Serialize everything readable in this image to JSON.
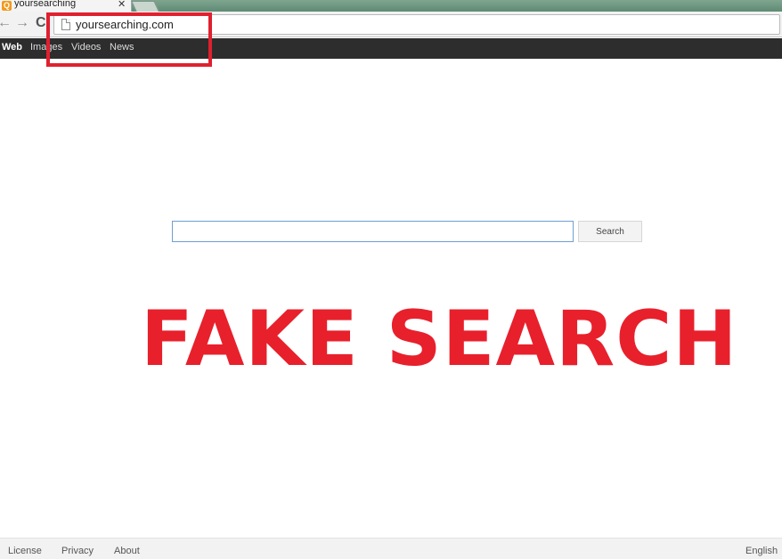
{
  "browser": {
    "tab": {
      "title": "yoursearching",
      "close_glyph": "✕",
      "favicon": "search-q-icon"
    },
    "nav": {
      "back_glyph": "←",
      "forward_glyph": "→",
      "reload_glyph": "C"
    },
    "address_bar": {
      "url": "yoursearching.com"
    }
  },
  "site_nav": {
    "items": [
      {
        "label": "Web",
        "active": true
      },
      {
        "label": "Images",
        "active": false
      },
      {
        "label": "Videos",
        "active": false
      },
      {
        "label": "News",
        "active": false
      }
    ]
  },
  "search": {
    "input_value": "",
    "button_label": "Search"
  },
  "overlay": {
    "title": "FAKE SEARCH",
    "color": "#e8202c"
  },
  "footer": {
    "links": [
      "License",
      "Privacy",
      "About"
    ],
    "language": "English"
  },
  "colors": {
    "highlight": "#e0202f",
    "nav_bar": "#2d2d2d",
    "input_border": "#6f9fd4"
  }
}
